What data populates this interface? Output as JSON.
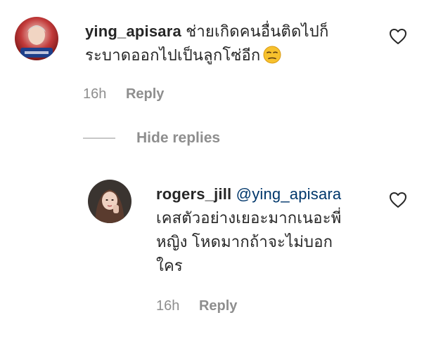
{
  "comments": {
    "main": {
      "username": "ying_apisara",
      "text_line1": "ช่ายเกิดคนอื่นติดไปก็",
      "text_line2": "ระบาดออกไปเป็นลูกโซ่อีก",
      "emoji": "unamused-face-emoji",
      "time": "16h",
      "reply_label": "Reply",
      "like_icon": "heart-outline-icon"
    },
    "toggle": {
      "label": "Hide replies"
    },
    "reply": {
      "username": "rogers_jill",
      "mention": "@ying_apisara",
      "text_line1": "เคสตัวอย่างเยอะมากเนอะพี่",
      "text_line2": "หญิง โหดมากถ้าจะไม่บอก",
      "text_line3": "ใคร",
      "time": "16h",
      "reply_label": "Reply",
      "like_icon": "heart-outline-icon"
    }
  },
  "colors": {
    "text": "#262626",
    "secondary": "#8e8e8e",
    "mention": "#00376b",
    "divider": "#c7c7c7"
  }
}
